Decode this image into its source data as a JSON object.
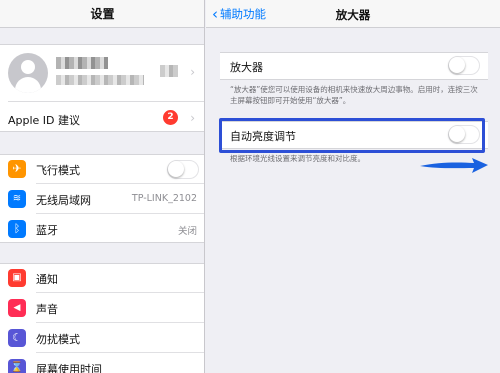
{
  "left": {
    "title": "设置",
    "apple_id_suggestion": "Apple ID 建议",
    "apple_id_badge": "2",
    "rows_group1": [
      {
        "label": "飞行模式",
        "icon": "airplane-icon",
        "color": "#ff9500",
        "glyph": "✈",
        "value": "",
        "toggle": true
      },
      {
        "label": "无线局域网",
        "icon": "wifi-icon",
        "color": "#007aff",
        "glyph": "≋",
        "value": "TP-LINK_2102",
        "toggle": false
      },
      {
        "label": "蓝牙",
        "icon": "bluetooth-icon",
        "color": "#007aff",
        "glyph": "ᛒ",
        "value": "关闭",
        "toggle": false
      }
    ],
    "rows_group2": [
      {
        "label": "通知",
        "icon": "notifications-icon",
        "color": "#ff3b30",
        "glyph": "▣"
      },
      {
        "label": "声音",
        "icon": "sound-icon",
        "color": "#ff2d55",
        "glyph": "◀"
      },
      {
        "label": "勿扰模式",
        "icon": "moon-icon",
        "color": "#5856d6",
        "glyph": "☾"
      },
      {
        "label": "屏幕使用时间",
        "icon": "hourglass-icon",
        "color": "#5856d6",
        "glyph": "⌛"
      }
    ]
  },
  "right": {
    "back_label": "辅助功能",
    "title": "放大器",
    "magnifier_label": "放大器",
    "magnifier_note": "“放大器”使您可以使用设备的相机来快速放大周边事物。启用时，连按三次主屏幕按钮即可开始使用“放大器”。",
    "auto_brightness_label": "自动亮度调节",
    "auto_brightness_note": "根据环境光线设置来调节亮度和对比度。"
  },
  "colors": {
    "accent": "#007aff",
    "highlight_box": "#2d4fd6",
    "arrow": "#1a62e0",
    "badge": "#ff3b30"
  }
}
